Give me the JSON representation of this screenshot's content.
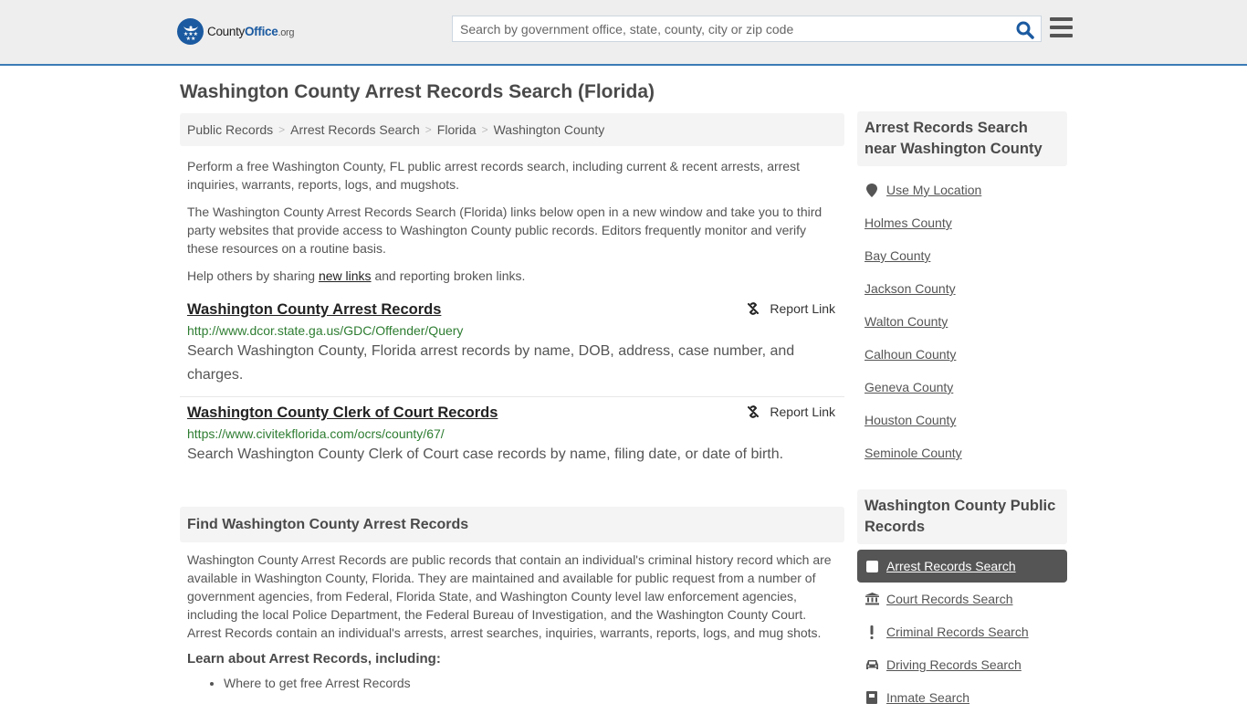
{
  "header": {
    "logo": {
      "name_part1": "County",
      "name_part2": "Office",
      "name_part3": ".org"
    },
    "search": {
      "placeholder": "Search by government office, state, county, city or zip code",
      "value": ""
    },
    "icons": {
      "search": "search-icon",
      "menu": "hamburger-menu-icon"
    }
  },
  "page": {
    "title": "Washington County Arrest Records Search (Florida)",
    "breadcrumb": [
      "Public Records",
      "Arrest Records Search",
      "Florida",
      "Washington County"
    ],
    "intro": {
      "p1": "Perform a free Washington County, FL public arrest records search, including current & recent arrests, arrest inquiries, warrants, reports, logs, and mugshots.",
      "p2": "The Washington County Arrest Records Search (Florida) links below open in a new window and take you to third party websites that provide access to Washington County public records. Editors frequently monitor and verify these resources on a routine basis.",
      "p3_before": "Help others by sharing ",
      "p3_link": "new links",
      "p3_after": " and reporting broken links."
    },
    "records": [
      {
        "title": "Washington County Arrest Records",
        "url": "http://www.dcor.state.ga.us/GDC/Offender/Query",
        "description": "Search Washington County, Florida arrest records by name, DOB, address, case number, and charges.",
        "report_label": "Report Link"
      },
      {
        "title": "Washington County Clerk of Court Records",
        "url": "https://www.civitekflorida.com/ocrs/county/67/",
        "description": "Search Washington County Clerk of Court case records by name, filing date, or date of birth.",
        "report_label": "Report Link"
      }
    ],
    "find_section": {
      "heading": "Find Washington County Arrest Records",
      "body": "Washington County Arrest Records are public records that contain an individual's criminal history record which are available in Washington County, Florida. They are maintained and available for public request from a number of government agencies, from Federal, Florida State, and Washington County level law enforcement agencies, including the local Police Department, the Federal Bureau of Investigation, and the Washington County Court. Arrest Records contain an individual's arrests, arrest searches, inquiries, warrants, reports, logs, and mug shots.",
      "learn_heading": "Learn about Arrest Records, including:",
      "learn_items": [
        "Where to get free Arrest Records"
      ]
    }
  },
  "sidebar": {
    "nearby": {
      "heading": "Arrest Records Search near Washington County",
      "use_location": "Use My Location",
      "counties": [
        "Holmes County",
        "Bay County",
        "Jackson County",
        "Walton County",
        "Calhoun County",
        "Geneva County",
        "Houston County",
        "Seminole County"
      ]
    },
    "public_records": {
      "heading": "Washington County Public Records",
      "items": [
        {
          "label": "Arrest Records Search",
          "icon": "square-icon",
          "active": true
        },
        {
          "label": "Court Records Search",
          "icon": "courthouse-icon",
          "active": false
        },
        {
          "label": "Criminal Records Search",
          "icon": "exclamation-icon",
          "active": false
        },
        {
          "label": "Driving Records Search",
          "icon": "car-icon",
          "active": false
        },
        {
          "label": "Inmate Search",
          "icon": "inmate-icon",
          "active": false
        }
      ]
    }
  },
  "colors": {
    "brand_blue": "#1b5aa0",
    "header_border": "#3b7bb5",
    "url_green": "#2e7d32",
    "active_bg": "#555555"
  }
}
